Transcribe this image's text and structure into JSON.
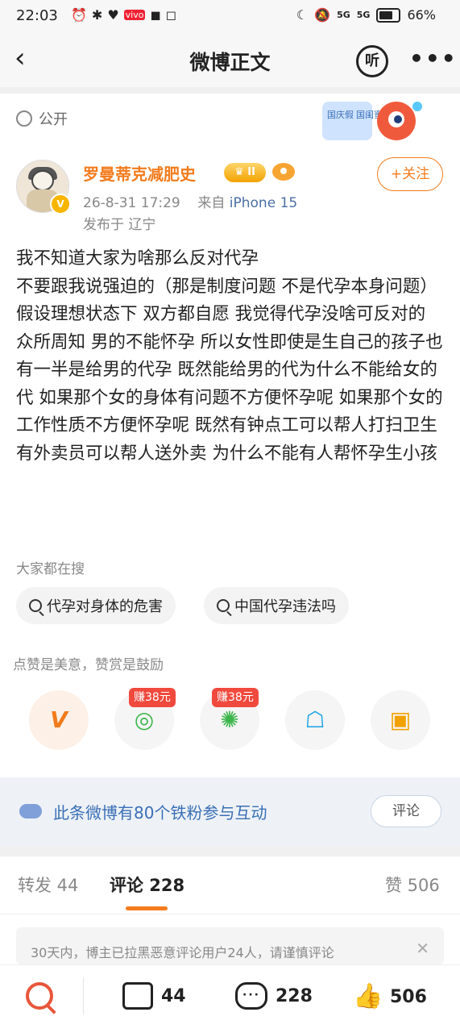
{
  "status_bar": {
    "time": "22:03",
    "left_icons": [
      "⏰",
      "✱",
      "♥",
      "vivo",
      "◼",
      "◻"
    ],
    "right_icons": [
      "☾",
      "🔕",
      "5G",
      "5G"
    ],
    "battery": "66%"
  },
  "nav": {
    "back_glyph": "‹",
    "title": "微博正文",
    "listen_label": "听",
    "more_glyph": "•••"
  },
  "privacy": {
    "label": "公开"
  },
  "banner": {
    "text": "国庆假 国闺蜜众"
  },
  "post": {
    "username": "罗曼蒂克减肥史",
    "level_badge": "♛ II",
    "meta_time": "26-8-31 17:29",
    "meta_from": "来自",
    "meta_device": "iPhone 15",
    "location": "发布于 辽宁",
    "follow_label": "+关注",
    "content": [
      "我不知道大家为啥那么反对代孕",
      "不要跟我说强迫的（那是制度问题 不是代孕本身问题）",
      "假设理想状态下 双方都自愿 我觉得代孕没啥可反对的",
      "众所周知 男的不能怀孕 所以女性即使是生自己的孩子也有一半是给男的代孕 既然能给男的代为什么不能给女的代 如果那个女的身体有问题不方便怀孕呢 如果那个女的工作性质不方便怀孕呢 既然有钟点工可以帮人打扫卫生 有外卖员可以帮人送外卖 为什么不能有人帮怀孕生小孩"
    ]
  },
  "search": {
    "title": "大家都在搜",
    "chips": [
      "代孕对身体的危害",
      "中国代孕违法吗"
    ]
  },
  "reward": {
    "note": "点赞是美意，赞赏是鼓励",
    "badge_1": "赚38元",
    "badge_2": "赚38元"
  },
  "iron_fans": {
    "text": "此条微博有80个铁粉参与互动",
    "button": "评论"
  },
  "tabs": {
    "repost": "转发 44",
    "comment": "评论 228",
    "like": "赞 506"
  },
  "notice": {
    "text": "30天内，博主已拉黑恶意评论用户24人，请谨慎评论",
    "close": "✕"
  },
  "bottom_bar": {
    "repost_count": "44",
    "comment_count": "228",
    "like_count": "506"
  },
  "colors": {
    "accent_orange": "#f37b1d",
    "link_blue": "#3a6fb6",
    "reward_red": "#f0493d"
  }
}
